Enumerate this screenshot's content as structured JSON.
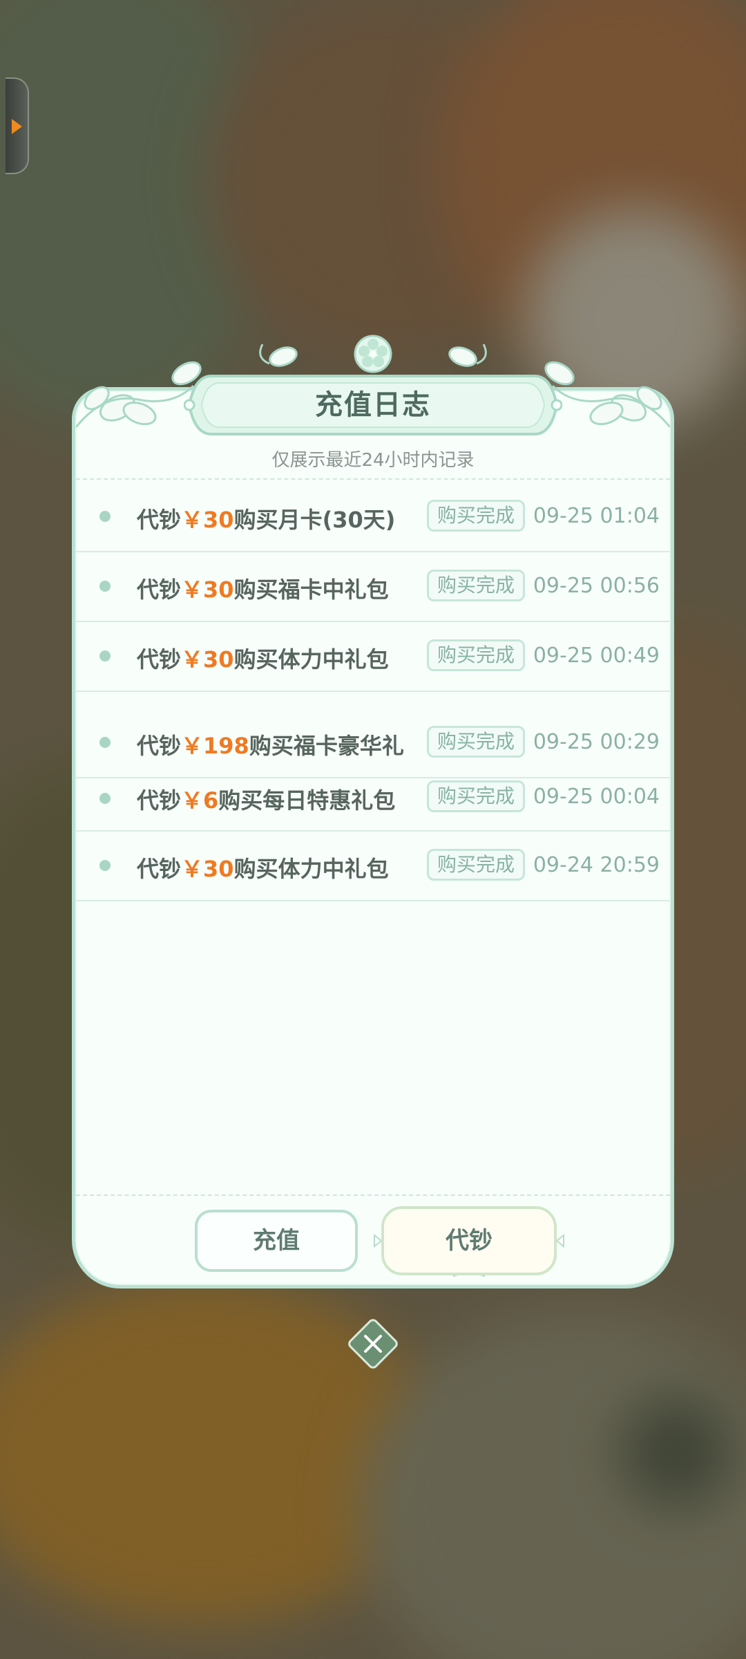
{
  "dialog": {
    "title": "充值日志",
    "subtitle": "仅展示最近24小时内记录"
  },
  "records": [
    {
      "prefix": "代钞",
      "amount": "￥30",
      "suffix": "购买月卡(30天)",
      "status": "购买完成",
      "time": "09-25 01:04"
    },
    {
      "prefix": "代钞",
      "amount": "￥30",
      "suffix": "购买福卡中礼包",
      "status": "购买完成",
      "time": "09-25 00:56"
    },
    {
      "prefix": "代钞",
      "amount": "￥30",
      "suffix": "购买体力中礼包",
      "status": "购买完成",
      "time": "09-25 00:49"
    },
    {
      "prefix": "代钞",
      "amount": "￥198",
      "suffix": "购买福卡豪华礼",
      "status": "购买完成",
      "time": "09-25 00:29"
    },
    {
      "prefix": "代钞",
      "amount": "￥6",
      "suffix": "购买每日特惠礼包",
      "status": "购买完成",
      "time": "09-25 00:04"
    },
    {
      "prefix": "代钞",
      "amount": "￥30",
      "suffix": "购买体力中礼包",
      "status": "购买完成",
      "time": "09-24 20:59"
    }
  ],
  "buttons": {
    "recharge_label": "充值",
    "proxy_label": "代钞"
  },
  "icons": {
    "close": "close-icon",
    "side_tab": "expand-arrow-icon"
  },
  "colors": {
    "amount": "#ef7a22",
    "accent": "#b9e2d3",
    "dialog_bg": "#f8fffb"
  }
}
